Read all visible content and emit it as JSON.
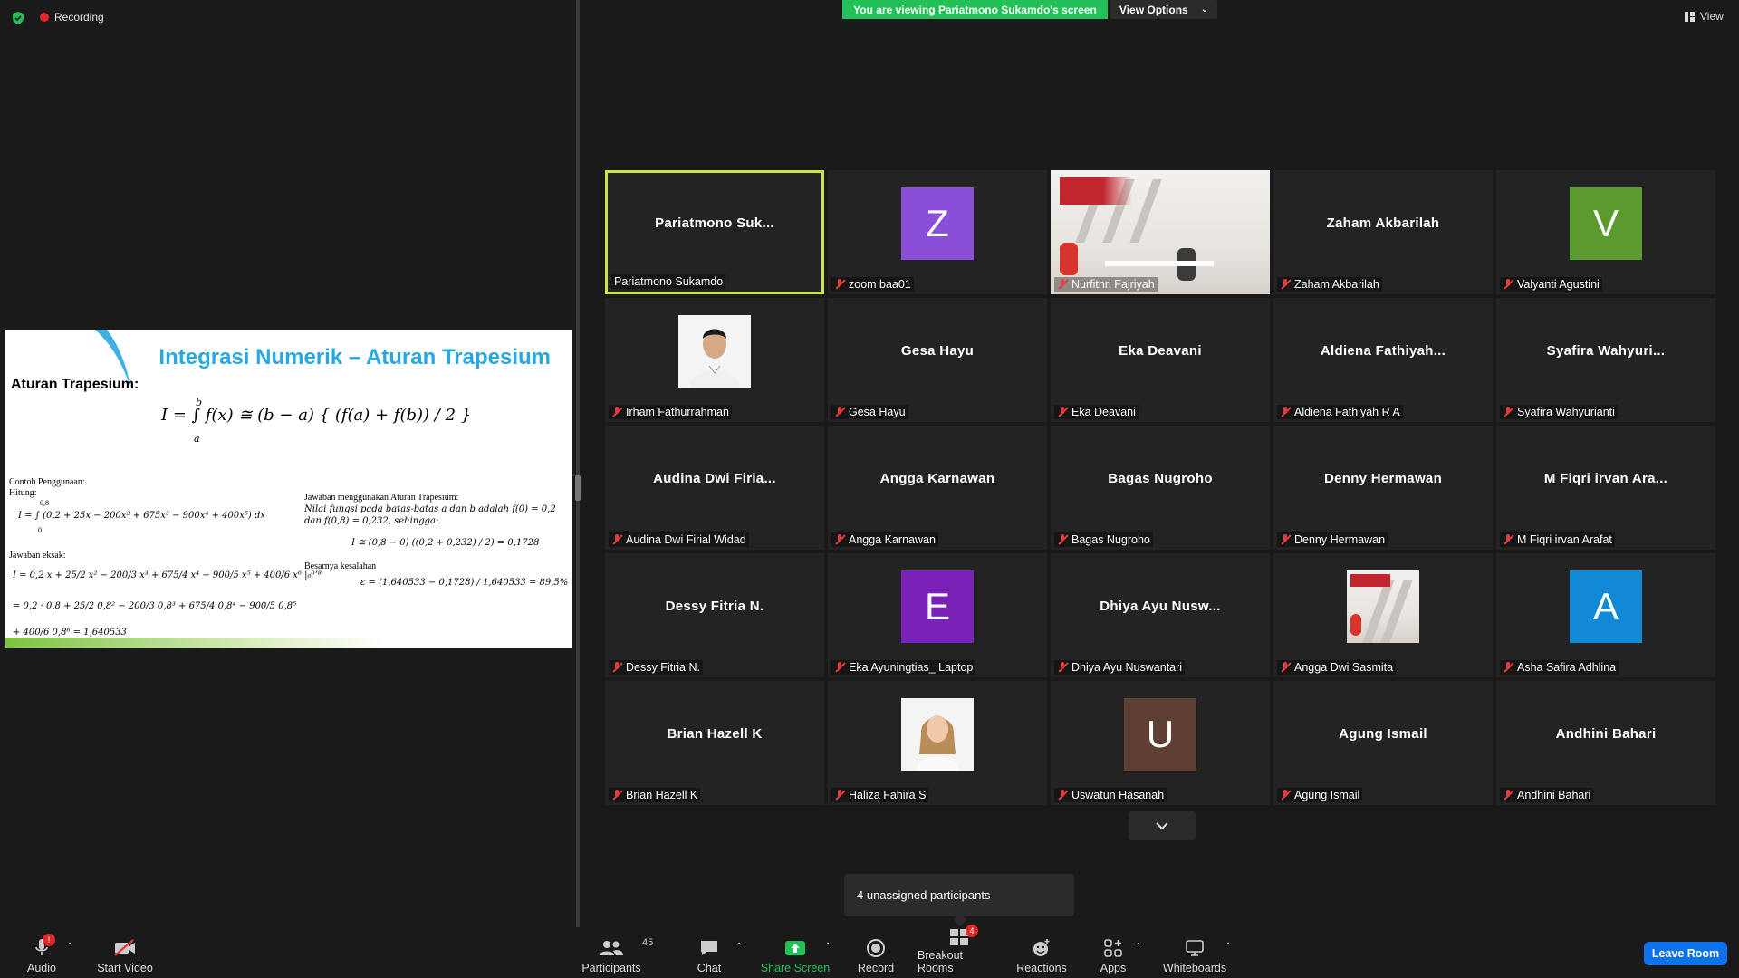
{
  "top": {
    "recording_label": "Recording",
    "viewing_banner": "You are viewing Pariatmono Sukamdo's screen",
    "view_options_label": "View Options",
    "view_label": "View"
  },
  "slide": {
    "title": "Integrasi Numerik – Aturan Trapesium",
    "subtitle": "Aturan Trapesium:",
    "formula": "I = ∫ f(x) ≅ (b − a) { (f(a) + f(b)) / 2 }",
    "formula_lower": "a",
    "formula_upper": "b",
    "example_heading": "Contoh Penggunaan:",
    "hitung": "Hitung:",
    "integral": "I = ∫ (0,2 + 25x − 200x² + 675x³ − 900x⁴ + 400x⁵) dx",
    "integral_upper": "0,8",
    "integral_lower": "0",
    "exact_heading": "Jawaban eksak:",
    "exact_line1": "I = 0,2 x + 25/2 x² − 200/3 x³ + 675/4 x⁴ − 900/5 x⁵ + 400/6 x⁶ |₀⁰ʼ⁸",
    "exact_line2": "= 0,2 · 0,8 + 25/2 0,8² − 200/3 0,8³ + 675/4 0,8⁴ − 900/5 0,8⁵",
    "exact_line3": "+ 400/6 0,8⁶ = 1,640533",
    "trap_heading": "Jawaban menggunakan Aturan Trapesium:",
    "trap_line1": "Nilai fungsi pada batas-batas a dan b adalah f(0) = 0,2",
    "trap_line2": "dan f(0,8) = 0,232, sehingga:",
    "trap_formula": "I ≅ (0,8 − 0) ((0,2 + 0,232) / 2) = 0,1728",
    "error_heading": "Besarnya kesalahan",
    "error_formula": "ε = (1,640533 − 0,1728) / 1,640533 = 89,5%"
  },
  "participants_grid": [
    {
      "display": "name",
      "center_text": "Pariatmono  Suk...",
      "label": "Pariatmono Sukamdo",
      "muted": false,
      "active": true
    },
    {
      "display": "letter",
      "letter": "Z",
      "color": "#8a4fd6",
      "label": "zoom baa01",
      "muted": true
    },
    {
      "display": "room",
      "label": "Nurfithri Fajriyah",
      "muted": true
    },
    {
      "display": "name",
      "center_text": "Zaham Akbarilah",
      "label": "Zaham Akbarilah",
      "muted": true
    },
    {
      "display": "letter",
      "letter": "V",
      "color": "#5a9a2e",
      "label": "Valyanti Agustini",
      "muted": true
    },
    {
      "display": "photo-man",
      "label": "Irham Fathurrahman",
      "muted": true
    },
    {
      "display": "name",
      "center_text": "Gesa Hayu",
      "label": "Gesa Hayu",
      "muted": true
    },
    {
      "display": "name",
      "center_text": "Eka Deavani",
      "label": "Eka Deavani",
      "muted": true
    },
    {
      "display": "name",
      "center_text": "Aldiena  Fathiyah...",
      "label": "Aldiena Fathiyah R A",
      "muted": true
    },
    {
      "display": "name",
      "center_text": "Syafira  Wahyuri...",
      "label": "Syafira Wahyurianti",
      "muted": true
    },
    {
      "display": "name",
      "center_text": "Audina  Dwi  Firia...",
      "label": "Audina Dwi Firial Widad",
      "muted": true
    },
    {
      "display": "name",
      "center_text": "Angga Karnawan",
      "label": "Angga Karnawan",
      "muted": true
    },
    {
      "display": "name",
      "center_text": "Bagas Nugroho",
      "label": "Bagas Nugroho",
      "muted": true
    },
    {
      "display": "name",
      "center_text": "Denny Hermawan",
      "label": "Denny Hermawan",
      "muted": true
    },
    {
      "display": "name",
      "center_text": "M Fiqri irvan Ara...",
      "label": "M Fiqri irvan Arafat",
      "muted": true
    },
    {
      "display": "name",
      "center_text": "Dessy Fitria N.",
      "label": "Dessy Fitria N.",
      "muted": true
    },
    {
      "display": "letter",
      "letter": "E",
      "color": "#7a22b8",
      "label": "Eka Ayuningtias_ Laptop",
      "muted": true
    },
    {
      "display": "name",
      "center_text": "Dhiya Ayu Nusw...",
      "label": "Dhiya Ayu Nuswantari",
      "muted": true
    },
    {
      "display": "room-small",
      "label": "Angga Dwi Sasmita",
      "muted": true
    },
    {
      "display": "letter",
      "letter": "A",
      "color": "#1189d6",
      "label": "Asha Safira Adhlina",
      "muted": true
    },
    {
      "display": "name",
      "center_text": "Brian Hazell K",
      "label": "Brian Hazell K",
      "muted": true
    },
    {
      "display": "photo-woman",
      "label": "Haliza Fahira S",
      "muted": true
    },
    {
      "display": "letter",
      "letter": "U",
      "color": "#5e3f32",
      "label": "Uswatun Hasanah",
      "muted": true
    },
    {
      "display": "name",
      "center_text": "Agung Ismail",
      "label": "Agung Ismail",
      "muted": true
    },
    {
      "display": "name",
      "center_text": "Andhini Bahari",
      "label": "Andhini Bahari",
      "muted": true
    }
  ],
  "unassigned_text": "4 unassigned participants",
  "toolbar": {
    "audio_label": "Audio",
    "audio_badge": "!",
    "start_video_label": "Start Video",
    "participants_label": "Participants",
    "participants_count": "45",
    "chat_label": "Chat",
    "share_screen_label": "Share Screen",
    "record_label": "Record",
    "breakout_label": "Breakout Rooms",
    "breakout_badge": "4",
    "reactions_label": "Reactions",
    "apps_label": "Apps",
    "whiteboards_label": "Whiteboards",
    "leave_label": "Leave Room"
  },
  "colors": {
    "active_border": "#c8e54b",
    "share_green": "#23c05a",
    "leave_blue": "#0e72ed",
    "slide_title": "#28a8e0"
  }
}
